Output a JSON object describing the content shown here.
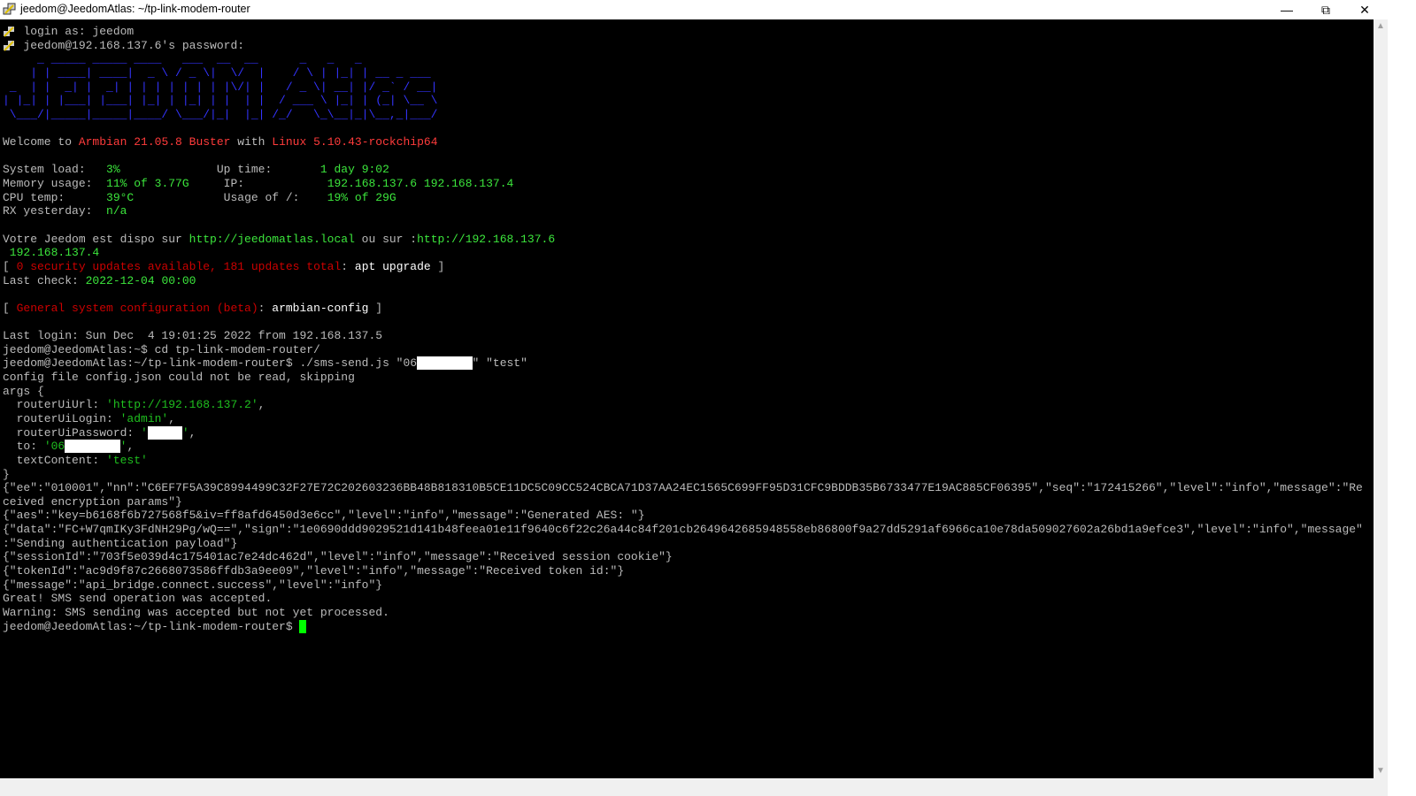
{
  "window": {
    "title": "jeedom@JeedomAtlas: ~/tp-link-modem-router",
    "minimize_icon": "minimize-icon",
    "restore_icon": "restore-icon",
    "close_icon": "close-icon"
  },
  "colors": {
    "background": "#000000",
    "default_text": "#bbbbbb",
    "green": "#3ce63c",
    "red": "#cc0000",
    "cursor": "#00ff00"
  },
  "terminal": {
    "lines": [
      [
        [
          "   login as: jeedom",
          "g"
        ]
      ],
      [
        [
          "   jeedom@192.168.137.6's password:",
          "g"
        ]
      ],
      [
        [
          "     _ _____ _____ ____   ___  __  __      _   _   _           ",
          "logo"
        ]
      ],
      [
        [
          "    | | ____| ____|  _ \\ / _ \\|  \\/  |    / \\ | |_| | __ _ ___ ",
          "logo"
        ]
      ],
      [
        [
          " _  | |  _| |  _| | | | | | | | |\\/| |   / _ \\| __| |/ _` / __|",
          "logo"
        ]
      ],
      [
        [
          "| |_| | |___| |___| |_| | |_| | |  | |  / ___ \\ |_| | (_| \\__ \\",
          "logo"
        ]
      ],
      [
        [
          " \\___/|_____|_____|____/ \\___/|_|  |_| /_/   \\_\\__|_|\\__,_|___/",
          "logo"
        ]
      ],
      [
        [
          "",
          "g"
        ]
      ],
      [
        [
          "Welcome to ",
          "g"
        ],
        [
          "Armbian 21.05.8 Buster",
          "br"
        ],
        [
          " with ",
          "g"
        ],
        [
          "Linux 5.10.43-rockchip64",
          "br"
        ]
      ],
      [
        [
          "",
          "g"
        ]
      ],
      [
        [
          "System load:   ",
          "g"
        ],
        [
          "3%",
          "gr"
        ],
        [
          "              Up time:       ",
          "g"
        ],
        [
          "1 day 9:02",
          "gr"
        ]
      ],
      [
        [
          "Memory usage:  ",
          "g"
        ],
        [
          "11% of 3.77G",
          "gr"
        ],
        [
          "     IP:            ",
          "g"
        ],
        [
          "192.168.137.6 192.168.137.4",
          "gr"
        ]
      ],
      [
        [
          "CPU temp:      ",
          "g"
        ],
        [
          "39°C",
          "gr"
        ],
        [
          "             Usage of /:    ",
          "g"
        ],
        [
          "19% of 29G",
          "gr"
        ]
      ],
      [
        [
          "RX yesterday:  ",
          "g"
        ],
        [
          "n/a",
          "gr"
        ]
      ],
      [
        [
          "",
          "g"
        ]
      ],
      [
        [
          "Votre Jeedom est dispo sur ",
          "g"
        ],
        [
          "http://jeedomatlas.local",
          "gr"
        ],
        [
          " ou sur :",
          "g"
        ],
        [
          "http://192.168.137.6",
          "gr"
        ]
      ],
      [
        [
          " 192.168.137.4",
          "gr"
        ]
      ],
      [
        [
          "[ ",
          "g"
        ],
        [
          "0 security updates available, 181 updates total",
          "r"
        ],
        [
          ": ",
          "g"
        ],
        [
          "apt upgrade",
          "w"
        ],
        [
          " ]",
          "g"
        ]
      ],
      [
        [
          "Last check: ",
          "g"
        ],
        [
          "2022-12-04 00:00",
          "gr"
        ]
      ],
      [
        [
          "",
          "g"
        ]
      ],
      [
        [
          "[ ",
          "g"
        ],
        [
          "General system configuration (beta)",
          "r"
        ],
        [
          ": ",
          "g"
        ],
        [
          "armbian-config",
          "w"
        ],
        [
          " ]",
          "g"
        ]
      ],
      [
        [
          "",
          "g"
        ]
      ],
      [
        [
          "Last login: Sun Dec  4 19:01:25 2022 from 192.168.137.5",
          "g"
        ]
      ],
      [
        [
          "jeedom@JeedomAtlas:~$ cd tp-link-modem-router/",
          "g"
        ]
      ],
      [
        [
          "jeedom@JeedomAtlas:~/tp-link-modem-router$ ./sms-send.js \"06",
          "g"
        ],
        [
          "        ",
          "mask"
        ],
        [
          "\" \"test\"",
          "g"
        ]
      ],
      [
        [
          "config file config.json could not be read, skipping",
          "g"
        ]
      ],
      [
        [
          "args {",
          "g"
        ]
      ],
      [
        [
          "  routerUiUrl: ",
          "g"
        ],
        [
          "'http://192.168.137.2'",
          "dg"
        ],
        [
          ",",
          "g"
        ]
      ],
      [
        [
          "  routerUiLogin: ",
          "g"
        ],
        [
          "'admin'",
          "dg"
        ],
        [
          ",",
          "g"
        ]
      ],
      [
        [
          "  routerUiPassword: ",
          "g"
        ],
        [
          "'",
          "dg"
        ],
        [
          "     ",
          "mask"
        ],
        [
          "'",
          "dg"
        ],
        [
          ",",
          "g"
        ]
      ],
      [
        [
          "  to: ",
          "g"
        ],
        [
          "'06",
          "dg"
        ],
        [
          "        ",
          "mask"
        ],
        [
          "'",
          "dg"
        ],
        [
          ",",
          "g"
        ]
      ],
      [
        [
          "  textContent: ",
          "g"
        ],
        [
          "'test'",
          "dg"
        ]
      ],
      [
        [
          "}",
          "g"
        ]
      ],
      [
        [
          "{\"ee\":\"010001\",\"nn\":\"C6EF7F5A39C8994499C32F27E72C202603236BB48B818310B5CE11DC5C09CC524CBCA71D37AA24EC1565C699FF95D31CFC9BDDB35B6733477E19AC885CF06395\",\"seq\":\"172415266\",\"level\":\"info\",\"message\":\"Re",
          "g"
        ]
      ],
      [
        [
          "ceived encryption params\"}",
          "g"
        ]
      ],
      [
        [
          "{\"aes\":\"key=b6168f6b727568f5&iv=ff8afd6450d3e6cc\",\"level\":\"info\",\"message\":\"Generated AES: \"}",
          "g"
        ]
      ],
      [
        [
          "{\"data\":\"FC+W7qmIKy3FdNH29Pg/wQ==\",\"sign\":\"1e0690ddd9029521d141b48feea01e11f9640c6f22c26a44c84f201cb2649642685948558eb86800f9a27dd5291af6966ca10e78da509027602a26bd1a9efce3\",\"level\":\"info\",\"message\"",
          "g"
        ]
      ],
      [
        [
          ":\"Sending authentication payload\"}",
          "g"
        ]
      ],
      [
        [
          "{\"sessionId\":\"703f5e039d4c175401ac7e24dc462d\",\"level\":\"info\",\"message\":\"Received session cookie\"}",
          "g"
        ]
      ],
      [
        [
          "{\"tokenId\":\"ac9d9f87c2668073586ffdb3a9ee09\",\"level\":\"info\",\"message\":\"Received token id:\"}",
          "g"
        ]
      ],
      [
        [
          "{\"message\":\"api_bridge.connect.success\",\"level\":\"info\"}",
          "g"
        ]
      ],
      [
        [
          "Great! SMS send operation was accepted.",
          "g"
        ]
      ],
      [
        [
          "Warning: SMS sending was accepted but not yet processed.",
          "g"
        ]
      ],
      [
        [
          "jeedom@JeedomAtlas:~/tp-link-modem-router$ ",
          "g"
        ]
      ]
    ]
  }
}
